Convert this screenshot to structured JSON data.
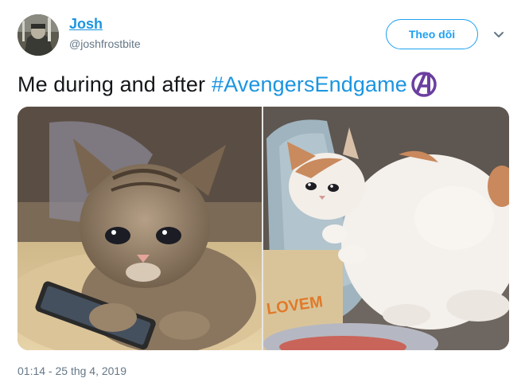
{
  "author": {
    "display_name": "Josh",
    "handle": "@joshfrostbite"
  },
  "follow_button_label": "Theo dõi",
  "tweet": {
    "text": "Me during and after",
    "hashtag": "#AvengersEndgame"
  },
  "media": {
    "photos": [
      {
        "subject": "crying tabby kitten holding a phone"
      },
      {
        "subject": "crying chubby white-and-orange cat lying on a sofa",
        "pillow_text": "LOVEM"
      }
    ]
  },
  "timestamp": "01:14 - 25 thg 4, 2019",
  "colors": {
    "link_blue": "#1b95e0",
    "button_blue": "#1da1f2",
    "avengers_purple": "#6b3fa0",
    "meta_gray": "#657786"
  }
}
